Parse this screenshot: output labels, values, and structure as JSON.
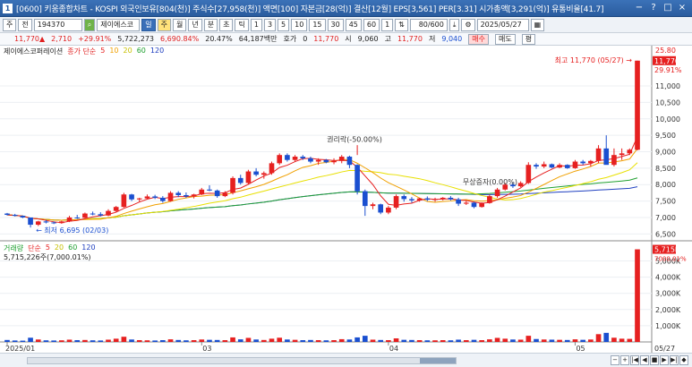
{
  "window": {
    "title": "[0600] 키움종합차트 - KOSPI 외국인보유[804(천)] 주식수[27,958(천)] 액면[100] 자본금[28(억)] 결산[12월] EPS[3,561] PER[3.31] 시가총액[3,291(억)] 유통비율[41.7]",
    "app_id": "1",
    "btn_min": "−",
    "btn_help": "?",
    "btn_max": "□",
    "btn_close": "×"
  },
  "toolbar": {
    "menu": "주",
    "period": "전",
    "code": "194370",
    "stock_name": "제이에스코",
    "mode_btn": "일",
    "tabs": [
      "주",
      "월",
      "년",
      "분",
      "초",
      "틱"
    ],
    "intervals": [
      "1",
      "3",
      "5",
      "10",
      "15",
      "30",
      "45",
      "60"
    ],
    "count_prefix": "1",
    "count_value": "80/600",
    "date": "2025/05/27"
  },
  "quote": {
    "price": "11,770",
    "arrow": "▲",
    "change": "2,710",
    "change_pct": "+29.91%",
    "volume": "5,722,273",
    "vol_ratio": "6,690.84%",
    "turnover": "20.47%",
    "amount": "64,187백만",
    "hoga_label": "호가",
    "hoga": "0",
    "hoga_price": "11,770",
    "open_label": "시",
    "open": "9,060",
    "high_label": "고",
    "high": "11,770",
    "low_label": "저",
    "low": "9,040",
    "buy": "매수",
    "sell": "매도",
    "flat": "평"
  },
  "price_legend": {
    "name": "제이에스코퍼레이션",
    "ma_label": "종가 단순",
    "ma": [
      "5",
      "10",
      "20",
      "60",
      "120"
    ]
  },
  "vol_legend": {
    "name": "거래량",
    "ma_label": "단순",
    "ma": [
      "5",
      "20",
      "60",
      "120"
    ],
    "value": "5,715,226주(7,000.01%)"
  },
  "annotations": {
    "high": "최고 11,770 (05/27)",
    "low": "최저 6,695 (02/03)",
    "ex_rights": "권리락(-50.00%)",
    "bonus_issue": "무상증자(0.00%)"
  },
  "price_axis": {
    "top": "25.80",
    "current": "11,770",
    "current_pct": "29.91%",
    "labels": [
      "11,000",
      "10,500",
      "10,000",
      "9,500",
      "9,000",
      "8,500",
      "8,000",
      "7,500",
      "7,000",
      "6,500"
    ]
  },
  "vol_axis": {
    "current": "5,715K",
    "current_pct": "7000.01%",
    "labels": [
      "5,000K",
      "4,000K",
      "3,000K",
      "2,000K",
      "1,000K"
    ]
  },
  "x_axis": {
    "labels": [
      "2025/01",
      "03",
      "04",
      "05"
    ],
    "end": "05/27"
  },
  "chart_data": {
    "type": "candlestick",
    "title": "제이에스코퍼레이션",
    "ylim": [
      6400,
      11900
    ],
    "candles": [
      [
        7120,
        7140,
        7060,
        7080
      ],
      [
        7080,
        7110,
        7030,
        7050
      ],
      [
        7050,
        7060,
        6980,
        7000
      ],
      [
        7000,
        6995,
        6695,
        6780
      ],
      [
        6780,
        6900,
        6740,
        6880
      ],
      [
        6880,
        6930,
        6820,
        6850
      ],
      [
        6850,
        6880,
        6800,
        6830
      ],
      [
        6830,
        6900,
        6810,
        6880
      ],
      [
        6880,
        7050,
        6860,
        7000
      ],
      [
        7000,
        7080,
        6960,
        6990
      ],
      [
        6990,
        7150,
        6980,
        7120
      ],
      [
        7120,
        7180,
        7070,
        7100
      ],
      [
        7100,
        7160,
        7030,
        7060
      ],
      [
        7060,
        7250,
        7040,
        7200
      ],
      [
        7200,
        7350,
        7150,
        7320
      ],
      [
        7320,
        7750,
        7300,
        7700
      ],
      [
        7700,
        7720,
        7500,
        7550
      ],
      [
        7550,
        7600,
        7480,
        7580
      ],
      [
        7580,
        7700,
        7550,
        7640
      ],
      [
        7640,
        7690,
        7560,
        7600
      ],
      [
        7600,
        7650,
        7450,
        7500
      ],
      [
        7500,
        7800,
        7480,
        7750
      ],
      [
        7750,
        7800,
        7620,
        7680
      ],
      [
        7680,
        7760,
        7600,
        7640
      ],
      [
        7640,
        7720,
        7580,
        7700
      ],
      [
        7700,
        7900,
        7680,
        7850
      ],
      [
        7850,
        7980,
        7800,
        7820
      ],
      [
        7820,
        7850,
        7600,
        7650
      ],
      [
        7650,
        7800,
        7620,
        7750
      ],
      [
        7750,
        8250,
        7700,
        8200
      ],
      [
        8200,
        8300,
        8000,
        8050
      ],
      [
        8050,
        8450,
        8000,
        8400
      ],
      [
        8400,
        8500,
        8250,
        8300
      ],
      [
        8300,
        8400,
        8180,
        8350
      ],
      [
        8350,
        8700,
        8300,
        8650
      ],
      [
        8650,
        8950,
        8600,
        8900
      ],
      [
        8900,
        8950,
        8700,
        8750
      ],
      [
        8750,
        8900,
        8700,
        8850
      ],
      [
        8850,
        8900,
        8750,
        8800
      ],
      [
        8800,
        8850,
        8650,
        8700
      ],
      [
        8700,
        8800,
        8600,
        8750
      ],
      [
        8750,
        8780,
        8650,
        8680
      ],
      [
        8680,
        8800,
        8620,
        8720
      ],
      [
        8720,
        8900,
        8650,
        8850
      ],
      [
        8850,
        8880,
        8500,
        8600
      ],
      [
        8600,
        8620,
        7700,
        7800
      ],
      [
        7800,
        7850,
        7050,
        7350
      ],
      [
        7350,
        7450,
        7250,
        7400
      ],
      [
        7400,
        7420,
        7100,
        7150
      ],
      [
        7150,
        7350,
        7100,
        7300
      ],
      [
        7300,
        7700,
        7250,
        7650
      ],
      [
        7650,
        7700,
        7480,
        7560
      ],
      [
        7560,
        7620,
        7450,
        7520
      ],
      [
        7520,
        7600,
        7480,
        7580
      ],
      [
        7580,
        7640,
        7500,
        7540
      ],
      [
        7540,
        7600,
        7480,
        7560
      ],
      [
        7560,
        7620,
        7520,
        7600
      ],
      [
        7600,
        7650,
        7520,
        7550
      ],
      [
        7550,
        7600,
        7350,
        7420
      ],
      [
        7420,
        7500,
        7380,
        7450
      ],
      [
        7450,
        7480,
        7280,
        7320
      ],
      [
        7320,
        7460,
        7300,
        7440
      ],
      [
        7440,
        7700,
        7420,
        7650
      ],
      [
        7650,
        7900,
        7600,
        7850
      ],
      [
        7850,
        8050,
        7820,
        8000
      ],
      [
        8000,
        8050,
        7900,
        7950
      ],
      [
        7950,
        8100,
        7920,
        8050
      ],
      [
        8050,
        8680,
        8020,
        8600
      ],
      [
        8600,
        8650,
        8480,
        8550
      ],
      [
        8550,
        8700,
        8500,
        8620
      ],
      [
        8620,
        8640,
        8500,
        8520
      ],
      [
        8520,
        8650,
        8500,
        8600
      ],
      [
        8600,
        8620,
        8480,
        8500
      ],
      [
        8500,
        8750,
        8480,
        8700
      ],
      [
        8700,
        8750,
        8600,
        8650
      ],
      [
        8650,
        8750,
        8550,
        8720
      ],
      [
        8720,
        9200,
        8650,
        9100
      ],
      [
        9100,
        9500,
        8700,
        8600
      ],
      [
        8600,
        9100,
        8550,
        8900
      ],
      [
        8900,
        9100,
        8750,
        8950
      ],
      [
        8950,
        9100,
        8900,
        9060
      ],
      [
        9060,
        11770,
        9040,
        11770
      ]
    ],
    "volumes": [
      120,
      90,
      80,
      260,
      150,
      100,
      90,
      100,
      140,
      110,
      120,
      100,
      90,
      140,
      200,
      320,
      150,
      110,
      100,
      90,
      110,
      160,
      120,
      100,
      110,
      150,
      130,
      120,
      110,
      280,
      160,
      250,
      150,
      120,
      200,
      260,
      150,
      130,
      110,
      120,
      110,
      100,
      110,
      170,
      150,
      280,
      380,
      140,
      120,
      110,
      220,
      130,
      120,
      110,
      100,
      100,
      110,
      100,
      140,
      110,
      130,
      110,
      160,
      250,
      200,
      150,
      140,
      380,
      180,
      150,
      140,
      130,
      120,
      160,
      130,
      150,
      480,
      560,
      260,
      200,
      190,
      5715
    ]
  },
  "colors": {
    "up": "#e62020",
    "down": "#1a4fd0",
    "ma5": "#e62020",
    "ma10": "#f0a000",
    "ma20": "#e8e000",
    "ma60": "#20a030",
    "ma120": "#2040c0"
  }
}
